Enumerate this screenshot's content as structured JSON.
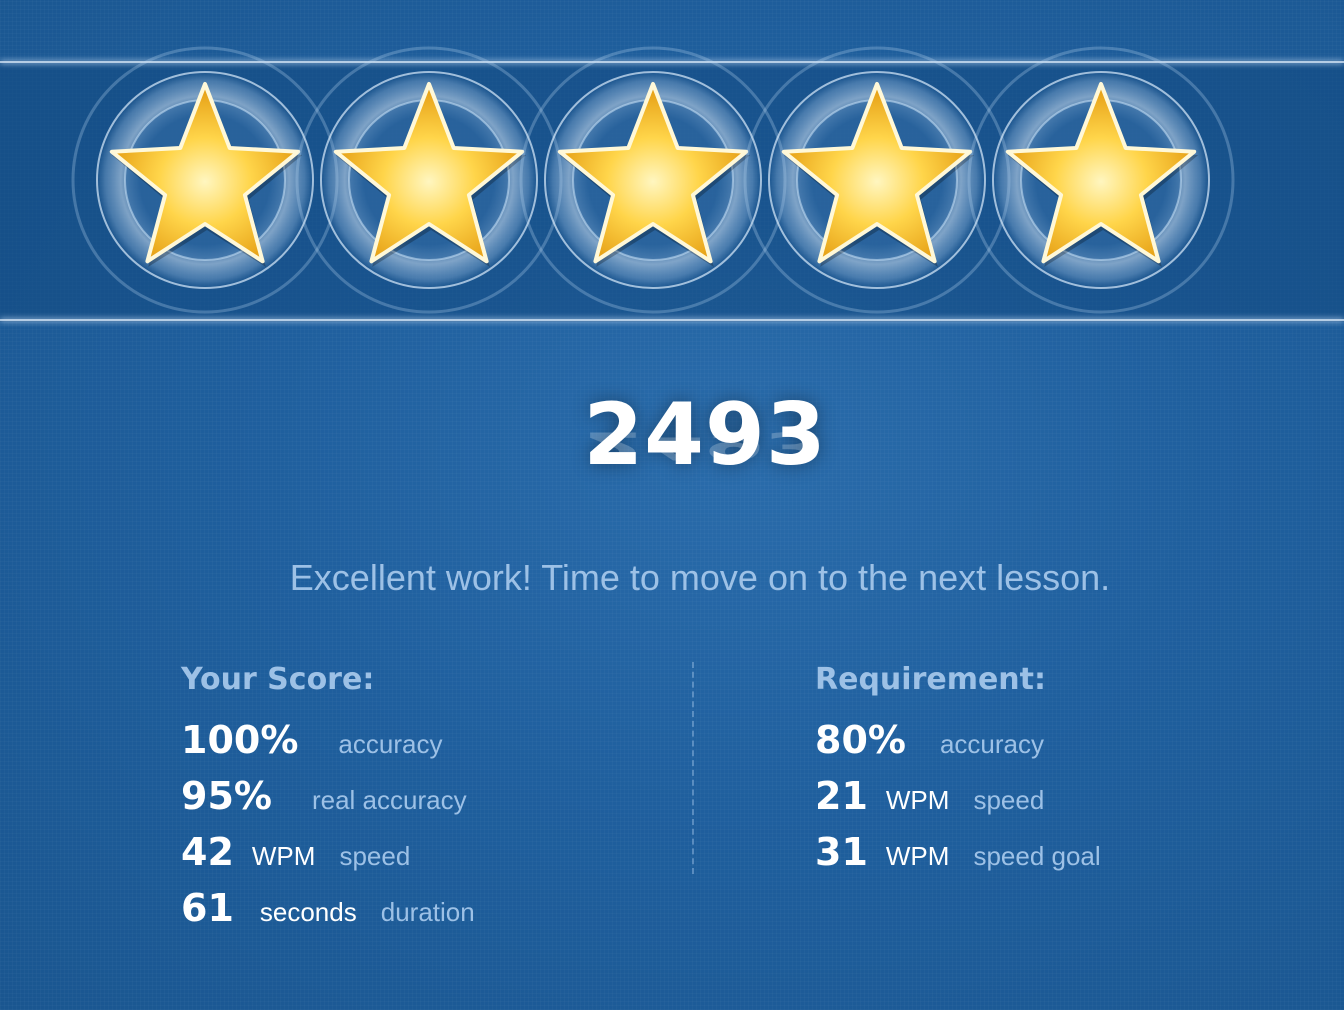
{
  "rating": {
    "stars_earned": 5,
    "stars_total": 5
  },
  "score": "2493",
  "message": "Excellent work! Time to move on to the next lesson.",
  "your_score": {
    "heading": "Your Score:",
    "rows": [
      {
        "value": "100%",
        "unit": "",
        "label": "accuracy"
      },
      {
        "value": "95%",
        "unit": "",
        "label": "real accuracy"
      },
      {
        "value": "42",
        "unit": "WPM",
        "label": "speed"
      },
      {
        "value": "61",
        "unit": "seconds",
        "label": "duration"
      }
    ]
  },
  "requirement": {
    "heading": "Requirement:",
    "rows": [
      {
        "value": "80%",
        "unit": "",
        "label": "accuracy"
      },
      {
        "value": "21",
        "unit": "WPM",
        "label": "speed"
      },
      {
        "value": "31",
        "unit": "WPM",
        "label": "speed goal"
      }
    ]
  },
  "colors": {
    "background": "#1f5f9e",
    "label_text": "#9dc1e6",
    "value_text": "#ffffff",
    "star_gold": "#f5b820",
    "star_highlight": "#fff3b0"
  },
  "icons": {
    "star": "star-icon"
  }
}
